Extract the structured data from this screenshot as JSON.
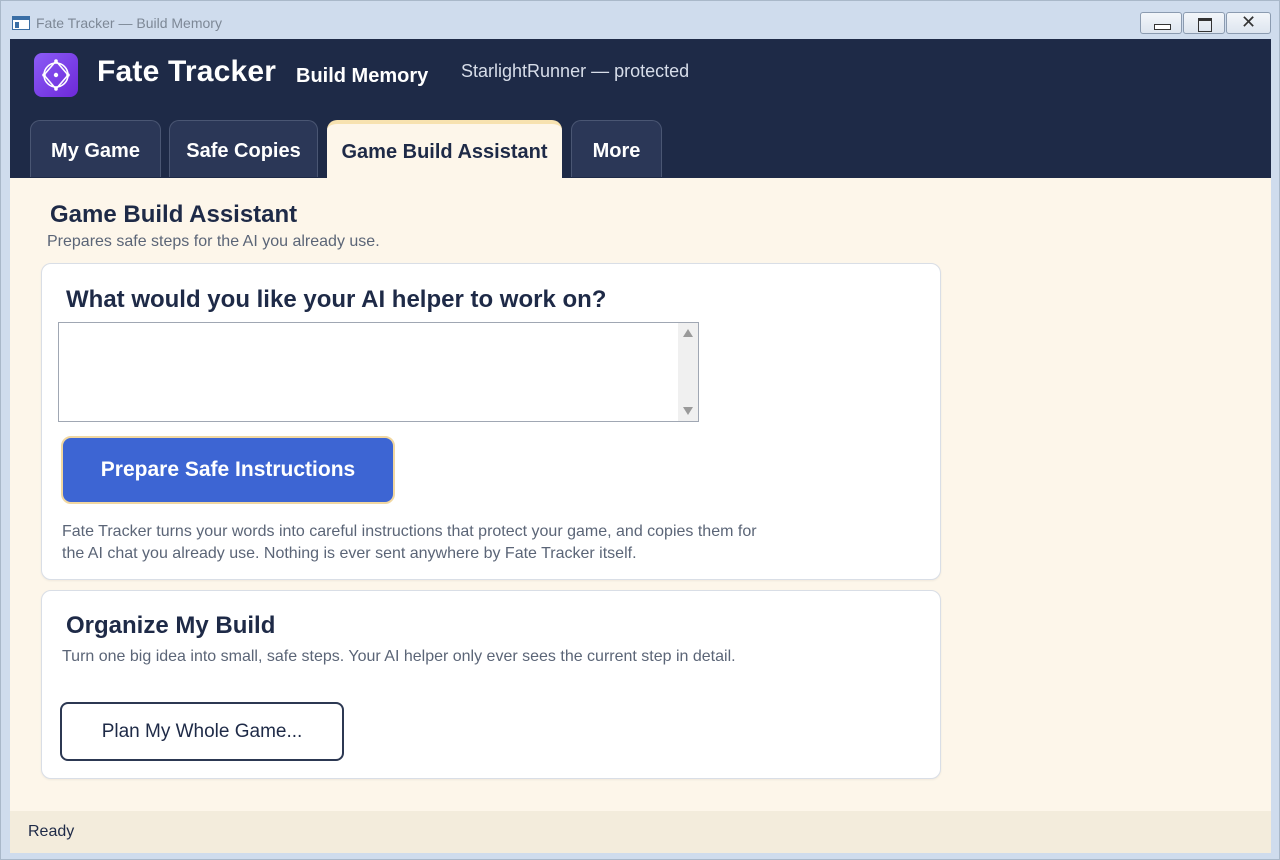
{
  "window": {
    "title": "Fate Tracker — Build Memory",
    "close_glyph": "✕"
  },
  "header": {
    "app_name": "Fate Tracker",
    "subtitle": "Build Memory",
    "user_status": "StarlightRunner — protected",
    "logo_icon": "compass-diamond-icon",
    "logo_color": "#7c3aed"
  },
  "tabs": [
    {
      "label": "My Game",
      "active": false
    },
    {
      "label": "Safe Copies",
      "active": false
    },
    {
      "label": "Game Build Assistant",
      "active": true
    },
    {
      "label": "More",
      "active": false
    }
  ],
  "page": {
    "title": "Game Build Assistant",
    "subtitle": "Prepares safe steps for the AI you already use."
  },
  "assistant_card": {
    "heading": "What would you like your AI helper to work on?",
    "input_value": "",
    "button_label": "Prepare Safe Instructions",
    "note": "Fate Tracker turns your words into careful instructions that protect your game, and copies them for the AI chat you already use. Nothing is ever sent anywhere by Fate Tracker itself."
  },
  "organize_card": {
    "heading": "Organize My Build",
    "note": "Turn one big idea into small, safe steps. Your AI helper only ever sees the current step in detail.",
    "button_label": "Plan My Whole Game..."
  },
  "status": {
    "text": "Ready"
  },
  "colors": {
    "header_bg": "#1e2a47",
    "page_bg": "#fdf6ea",
    "primary_button": "#3d65d3",
    "accent_border": "#f1d7a0"
  }
}
